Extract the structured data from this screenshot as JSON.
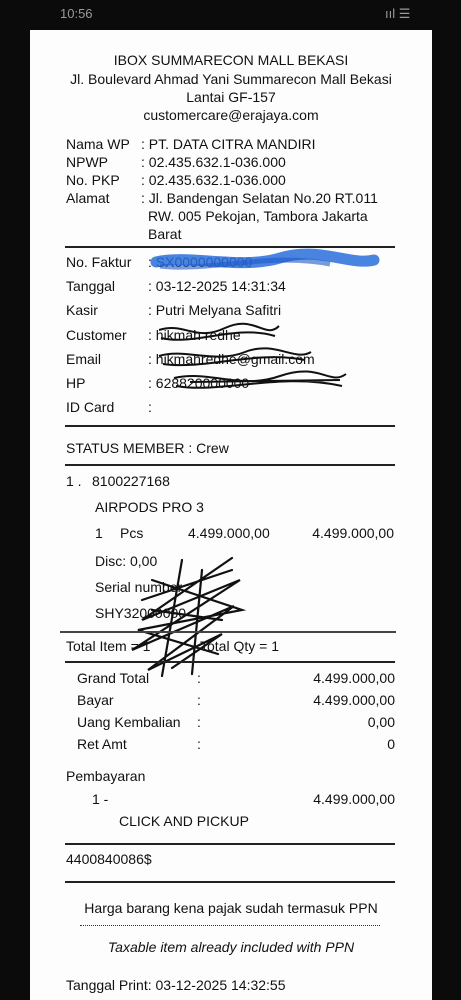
{
  "status_bar": {
    "time": "10:56",
    "signal": "ııl ☰"
  },
  "store": {
    "name": "IBOX SUMMARECON MALL BEKASI",
    "address_line1": "Jl. Boulevard Ahmad Yani Summarecon Mall Bekasi",
    "address_line2": "Lantai GF-157",
    "email": "customercare@erajaya.com"
  },
  "taxpayer": {
    "nama_wp_label": "Nama WP",
    "nama_wp_value": ": PT. DATA CITRA MANDIRI",
    "npwp_label": "NPWP",
    "npwp_value": ": 02.435.632.1-036.000",
    "pkp_label": "No. PKP",
    "pkp_value": ": 02.435.632.1-036.000",
    "alamat_label": "Alamat",
    "alamat_line1": ": Jl. Bandengan Selatan No.20 RT.011",
    "alamat_line2": "RW. 005  Pekojan, Tambora Jakarta",
    "alamat_line3": "Barat"
  },
  "transaction": {
    "faktur_label": "No. Faktur",
    "faktur_value": ": SX0000000000",
    "tanggal_label": "Tanggal",
    "tanggal_value": ": 03-12-2025 14:31:34",
    "kasir_label": "Kasir",
    "kasir_value": ": Putri Melyana Safitri",
    "customer_label": "Customer",
    "customer_value": ": hikmah redhe",
    "email_label": "Email",
    "email_value": ": hikmahredhe@gmail.com",
    "hp_label": "HP",
    "hp_value": ": 628820000000",
    "idcard_label": "ID Card",
    "idcard_value": ":"
  },
  "member_status": "STATUS MEMBER  : Crew",
  "item": {
    "index": "1 .",
    "code": "8100227168",
    "name": "AIRPODS PRO 3",
    "qty": "1",
    "unit": "Pcs",
    "price": "4.499.000,00",
    "subtotal": "4.499.000,00",
    "disc": "Disc: 0,00",
    "serial_label": "Serial number :",
    "serial_value": "SHY32000000"
  },
  "totals": {
    "total_item": "Total Item =  1",
    "total_qty": "Total Qty =  1",
    "rows": [
      {
        "label": "Grand Total",
        "value": "4.499.000,00"
      },
      {
        "label": "Bayar",
        "value": "4.499.000,00"
      },
      {
        "label": "Uang Kembalian",
        "value": "0,00"
      },
      {
        "label": "Ret Amt",
        "value": "0"
      }
    ],
    "colon": ":"
  },
  "payment": {
    "heading": "Pembayaran",
    "index": "1  -",
    "amount": "4.499.000,00",
    "method": "CLICK AND PICKUP"
  },
  "barcode_text": "4400840086$",
  "footer": {
    "ppn_note": "Harga barang kena pajak sudah termasuk PPN",
    "ppn_note_en": "Taxable item already included with PPN",
    "print_date": "Tanggal Print: 03-12-2025 14:32:55"
  }
}
